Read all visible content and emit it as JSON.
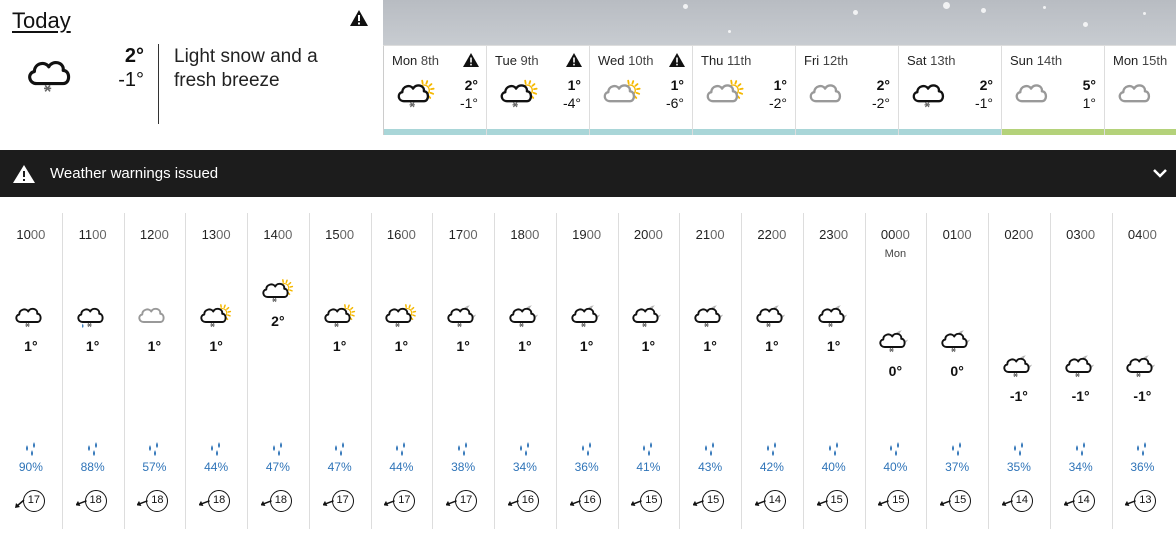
{
  "today": {
    "title": "Today",
    "max": "2°",
    "min": "-1°",
    "description": "Light snow and a fresh breeze",
    "icon": "cloud-snow-icon",
    "has_warning": true
  },
  "days": [
    {
      "name": "Mon",
      "date": "8th",
      "max": "2°",
      "min": "-1°",
      "icon": "cloud-snow-sun-icon",
      "warning": true,
      "bar_color": "#a9d6d8"
    },
    {
      "name": "Tue",
      "date": "9th",
      "max": "1°",
      "min": "-4°",
      "icon": "cloud-snow-sun-icon",
      "warning": true,
      "bar_color": "#a9d6d8"
    },
    {
      "name": "Wed",
      "date": "10th",
      "max": "1°",
      "min": "-6°",
      "icon": "grey-cloud-sun-icon",
      "warning": true,
      "bar_color": "#a9d6d8"
    },
    {
      "name": "Thu",
      "date": "11th",
      "max": "1°",
      "min": "-2°",
      "icon": "grey-cloud-sun-icon",
      "warning": false,
      "bar_color": "#a9d6d8"
    },
    {
      "name": "Fri",
      "date": "12th",
      "max": "2°",
      "min": "-2°",
      "icon": "grey-cloud-icon",
      "warning": false,
      "bar_color": "#a9d6d8"
    },
    {
      "name": "Sat",
      "date": "13th",
      "max": "2°",
      "min": "-1°",
      "icon": "cloud-snow-icon",
      "warning": false,
      "bar_color": "#a9d6d8"
    },
    {
      "name": "Sun",
      "date": "14th",
      "max": "5°",
      "min": "1°",
      "icon": "grey-cloud-icon",
      "warning": false,
      "bar_color": "#b4d27a"
    },
    {
      "name": "Mon",
      "date": "15th",
      "max": "",
      "min": "",
      "icon": "grey-cloud-icon",
      "warning": false,
      "bar_color": "#b4d27a"
    }
  ],
  "warnings": {
    "label": "Weather warnings issued",
    "icon": "warning-triangle-icon",
    "toggle_icon": "chevron-down-icon"
  },
  "hours": [
    {
      "hh": "10",
      "mm": "00",
      "sub": "",
      "icon": "cloud-snow-icon",
      "temp": "1°",
      "level": 0,
      "precip": "90%",
      "wind": "17",
      "wind_dir_deg": 225
    },
    {
      "hh": "11",
      "mm": "00",
      "sub": "",
      "icon": "cloud-snow-rain-icon",
      "temp": "1°",
      "level": 0,
      "precip": "88%",
      "wind": "18",
      "wind_dir_deg": 245
    },
    {
      "hh": "12",
      "mm": "00",
      "sub": "",
      "icon": "grey-cloud-icon",
      "temp": "1°",
      "level": 0,
      "precip": "57%",
      "wind": "18",
      "wind_dir_deg": 245
    },
    {
      "hh": "13",
      "mm": "00",
      "sub": "",
      "icon": "cloud-snow-sun-icon",
      "temp": "1°",
      "level": 0,
      "precip": "44%",
      "wind": "18",
      "wind_dir_deg": 245
    },
    {
      "hh": "14",
      "mm": "00",
      "sub": "",
      "icon": "cloud-snow-sun-icon",
      "temp": "2°",
      "level": 1,
      "precip": "47%",
      "wind": "18",
      "wind_dir_deg": 245
    },
    {
      "hh": "15",
      "mm": "00",
      "sub": "",
      "icon": "cloud-snow-sun-icon",
      "temp": "1°",
      "level": 0,
      "precip": "47%",
      "wind": "17",
      "wind_dir_deg": 245
    },
    {
      "hh": "16",
      "mm": "00",
      "sub": "",
      "icon": "cloud-snow-sun-icon",
      "temp": "1°",
      "level": 0,
      "precip": "44%",
      "wind": "17",
      "wind_dir_deg": 245
    },
    {
      "hh": "17",
      "mm": "00",
      "sub": "",
      "icon": "cloud-snow-moon-icon",
      "temp": "1°",
      "level": 0,
      "precip": "38%",
      "wind": "17",
      "wind_dir_deg": 245
    },
    {
      "hh": "18",
      "mm": "00",
      "sub": "",
      "icon": "cloud-snow-moon-icon",
      "temp": "1°",
      "level": 0,
      "precip": "34%",
      "wind": "16",
      "wind_dir_deg": 245
    },
    {
      "hh": "19",
      "mm": "00",
      "sub": "",
      "icon": "cloud-snow-moon-icon",
      "temp": "1°",
      "level": 0,
      "precip": "36%",
      "wind": "16",
      "wind_dir_deg": 245
    },
    {
      "hh": "20",
      "mm": "00",
      "sub": "",
      "icon": "cloud-snow-moon-icon",
      "temp": "1°",
      "level": 0,
      "precip": "41%",
      "wind": "15",
      "wind_dir_deg": 245
    },
    {
      "hh": "21",
      "mm": "00",
      "sub": "",
      "icon": "cloud-snow-moon-icon",
      "temp": "1°",
      "level": 0,
      "precip": "43%",
      "wind": "15",
      "wind_dir_deg": 245
    },
    {
      "hh": "22",
      "mm": "00",
      "sub": "",
      "icon": "cloud-snow-moon-icon",
      "temp": "1°",
      "level": 0,
      "precip": "42%",
      "wind": "14",
      "wind_dir_deg": 245
    },
    {
      "hh": "23",
      "mm": "00",
      "sub": "",
      "icon": "cloud-snow-moon-icon",
      "temp": "1°",
      "level": 0,
      "precip": "40%",
      "wind": "15",
      "wind_dir_deg": 245
    },
    {
      "hh": "00",
      "mm": "00",
      "sub": "Mon",
      "icon": "cloud-snow-moon-icon",
      "temp": "0°",
      "level": -1,
      "precip": "40%",
      "wind": "15",
      "wind_dir_deg": 245
    },
    {
      "hh": "01",
      "mm": "00",
      "sub": "",
      "icon": "cloud-snow-moon-icon",
      "temp": "0°",
      "level": -1,
      "precip": "37%",
      "wind": "15",
      "wind_dir_deg": 245
    },
    {
      "hh": "02",
      "mm": "00",
      "sub": "",
      "icon": "cloud-snow-moon-icon",
      "temp": "-1°",
      "level": -2,
      "precip": "35%",
      "wind": "14",
      "wind_dir_deg": 245
    },
    {
      "hh": "03",
      "mm": "00",
      "sub": "",
      "icon": "cloud-snow-moon-icon",
      "temp": "-1°",
      "level": -2,
      "precip": "34%",
      "wind": "14",
      "wind_dir_deg": 245
    },
    {
      "hh": "04",
      "mm": "00",
      "sub": "",
      "icon": "cloud-snow-moon-icon",
      "temp": "-1°",
      "level": -2,
      "precip": "36%",
      "wind": "13",
      "wind_dir_deg": 245
    }
  ],
  "colors": {
    "accent_blue": "#2f74b8",
    "sun_yellow": "#f5b800",
    "warning_bar_bg": "#1c1c1c"
  }
}
